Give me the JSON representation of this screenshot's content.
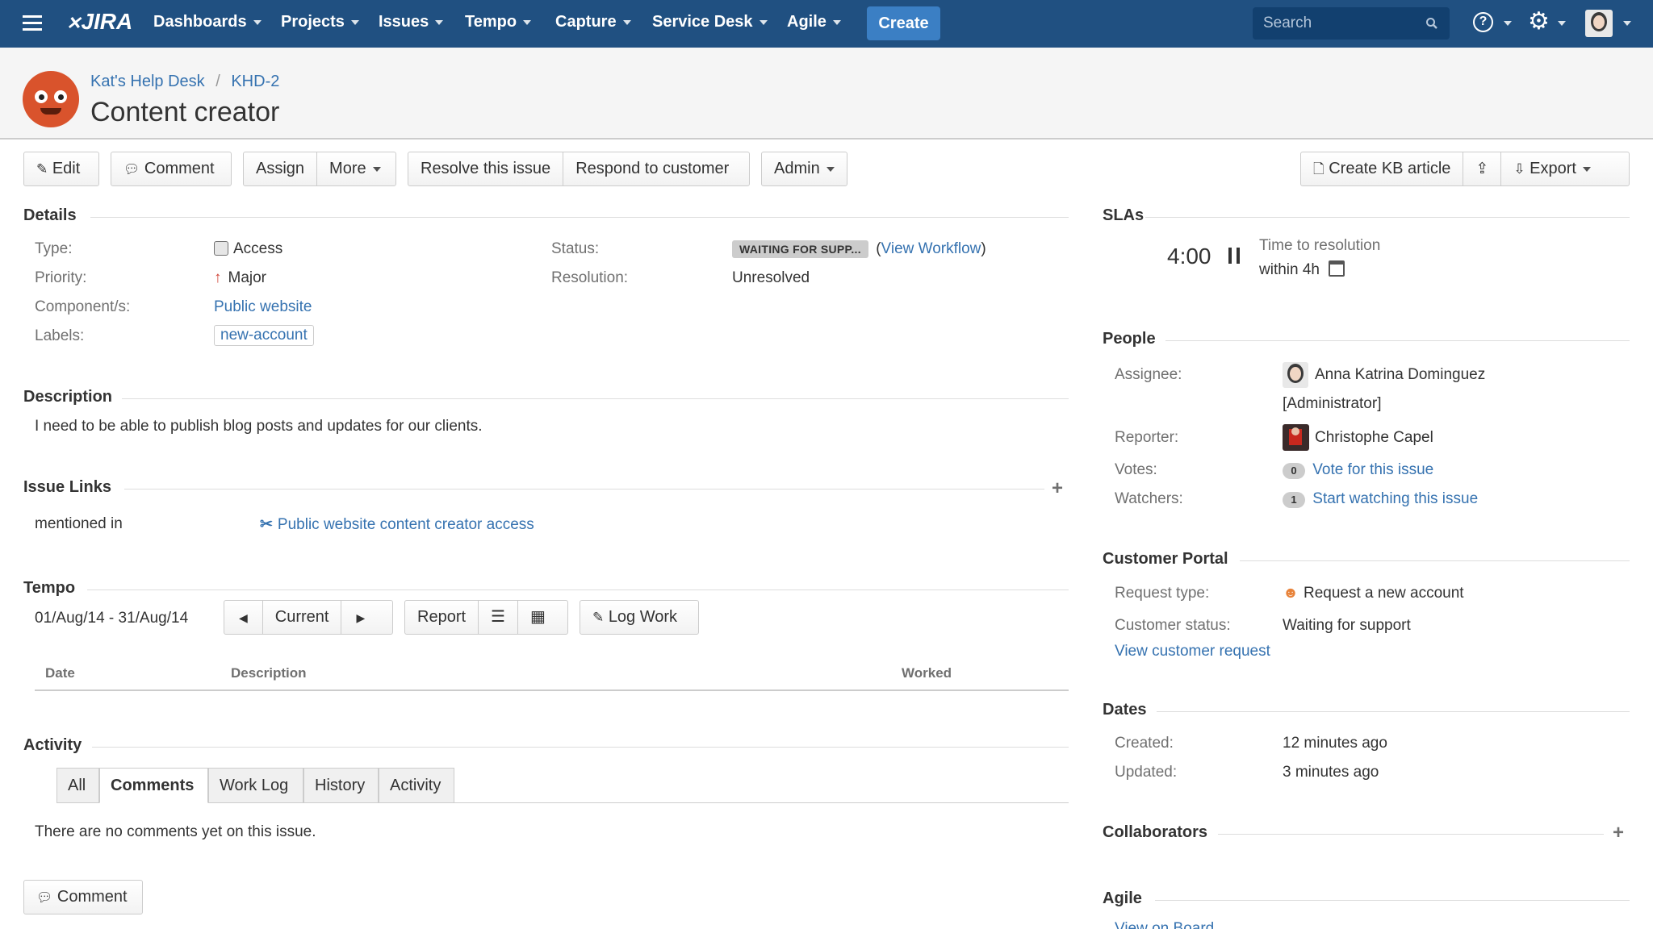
{
  "nav": {
    "logo": "JIRA",
    "items": [
      "Dashboards",
      "Projects",
      "Issues",
      "Tempo",
      "Capture",
      "Service Desk",
      "Agile"
    ],
    "create": "Create",
    "search_placeholder": "Search"
  },
  "header": {
    "breadcrumb_project": "Kat's Help Desk",
    "breadcrumb_sep": "/",
    "breadcrumb_key": "KHD-2",
    "title": "Content creator"
  },
  "toolbar": {
    "edit": "Edit",
    "comment": "Comment",
    "assign": "Assign",
    "more": "More",
    "resolve": "Resolve this issue",
    "respond": "Respond to customer",
    "admin": "Admin",
    "create_kb": "Create KB article",
    "export": "Export"
  },
  "details": {
    "title": "Details",
    "type_label": "Type:",
    "type_value": "Access",
    "priority_label": "Priority:",
    "priority_value": "Major",
    "components_label": "Component/s:",
    "components_value": "Public website",
    "labels_label": "Labels:",
    "labels_value": "new-account",
    "status_label": "Status:",
    "status_value": "WAITING FOR SUPP...",
    "view_workflow_open": "(",
    "view_workflow": "View Workflow",
    "view_workflow_close": ")",
    "resolution_label": "Resolution:",
    "resolution_value": "Unresolved"
  },
  "description": {
    "title": "Description",
    "text": "I need to be able to publish blog posts and updates for our clients."
  },
  "issue_links": {
    "title": "Issue Links",
    "relation": "mentioned in",
    "link": "Public website content creator access"
  },
  "tempo": {
    "title": "Tempo",
    "range": "01/Aug/14 - 31/Aug/14",
    "current": "Current",
    "report": "Report",
    "log_work": "Log Work",
    "col_date": "Date",
    "col_description": "Description",
    "col_worked": "Worked"
  },
  "activity": {
    "title": "Activity",
    "tabs": [
      "All",
      "Comments",
      "Work Log",
      "History",
      "Activity"
    ],
    "active_tab": "Comments",
    "empty": "There are no comments yet on this issue.",
    "comment_button": "Comment"
  },
  "slas": {
    "title": "SLAs",
    "timer": "4:00",
    "name": "Time to resolution",
    "goal": "within 4h"
  },
  "people": {
    "title": "People",
    "assignee_label": "Assignee:",
    "assignee": "Anna Katrina Dominguez",
    "assignee_role": "[Administrator]",
    "reporter_label": "Reporter:",
    "reporter": "Christophe Capel",
    "votes_label": "Votes:",
    "votes_count": "0",
    "votes_link": "Vote for this issue",
    "watchers_label": "Watchers:",
    "watchers_count": "1",
    "watchers_link": "Start watching this issue"
  },
  "customer_portal": {
    "title": "Customer Portal",
    "request_type_label": "Request type:",
    "request_type": "Request a new account",
    "status_label": "Customer status:",
    "status": "Waiting for support",
    "view_request": "View customer request"
  },
  "dates": {
    "title": "Dates",
    "created_label": "Created:",
    "created": "12 minutes ago",
    "updated_label": "Updated:",
    "updated": "3 minutes ago"
  },
  "collaborators": {
    "title": "Collaborators"
  },
  "agile": {
    "title": "Agile",
    "link": "View on Board"
  },
  "colors": {
    "nav_bg": "#205081",
    "create_btn": "#3b7fc4",
    "link": "#3572b0",
    "priority_major": "#d04437",
    "avatar_orange": "#d9532c"
  }
}
